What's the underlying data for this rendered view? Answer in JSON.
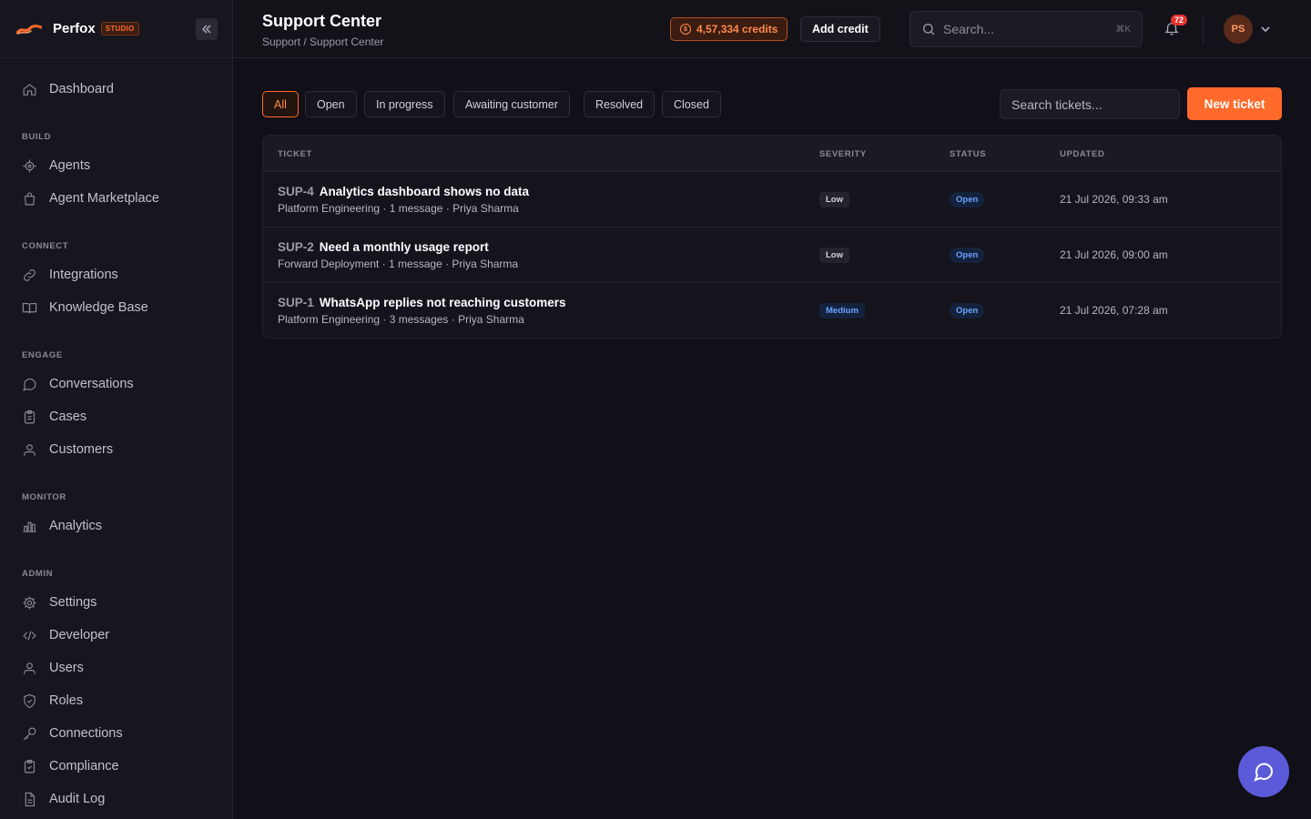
{
  "brand": {
    "name": "Perfox",
    "badge": "STUDIO"
  },
  "sidebar": {
    "dashboard": "Dashboard",
    "sections": {
      "build": "BUILD",
      "connect": "CONNECT",
      "engage": "ENGAGE",
      "monitor": "MONITOR",
      "admin": "ADMIN"
    },
    "items": {
      "agents": "Agents",
      "agent_marketplace": "Agent Marketplace",
      "integrations": "Integrations",
      "knowledge_base": "Knowledge Base",
      "conversations": "Conversations",
      "cases": "Cases",
      "customers": "Customers",
      "analytics": "Analytics",
      "settings": "Settings",
      "developer": "Developer",
      "users": "Users",
      "roles": "Roles",
      "connections": "Connections",
      "compliance": "Compliance",
      "audit_log": "Audit Log"
    }
  },
  "header": {
    "title": "Support Center",
    "breadcrumb": "Support / Support Center",
    "credits": "4,57,334 credits",
    "add_credit": "Add credit",
    "search_placeholder": "Search...",
    "search_shortcut": "⌘K",
    "notification_count": "72",
    "avatar_initials": "PS"
  },
  "filters": {
    "all": "All",
    "open": "Open",
    "in_progress": "In progress",
    "awaiting_customer": "Awaiting customer",
    "resolved": "Resolved",
    "closed": "Closed",
    "active": "All"
  },
  "ticket_search_placeholder": "Search tickets...",
  "new_ticket": "New ticket",
  "table": {
    "columns": [
      "TICKET",
      "SEVERITY",
      "STATUS",
      "UPDATED"
    ],
    "rows": [
      {
        "id": "SUP-4",
        "title": "Analytics dashboard shows no data",
        "meta": "Platform Engineering · 1 message · Priya Sharma",
        "severity": "Low",
        "status": "Open",
        "updated": "21 Jul 2026, 09:33 am"
      },
      {
        "id": "SUP-2",
        "title": "Need a monthly usage report",
        "meta": "Forward Deployment · 1 message · Priya Sharma",
        "severity": "Low",
        "status": "Open",
        "updated": "21 Jul 2026, 09:00 am"
      },
      {
        "id": "SUP-1",
        "title": "WhatsApp replies not reaching customers",
        "meta": "Platform Engineering · 3 messages · Priya Sharma",
        "severity": "Medium",
        "status": "Open",
        "updated": "21 Jul 2026, 07:28 am"
      }
    ]
  },
  "colors": {
    "accent": "#ff6a2b",
    "background": "#111018",
    "sidebar": "#17161f",
    "status_blue": "#6aa2ff",
    "chat_fab": "#5b5bd9"
  }
}
